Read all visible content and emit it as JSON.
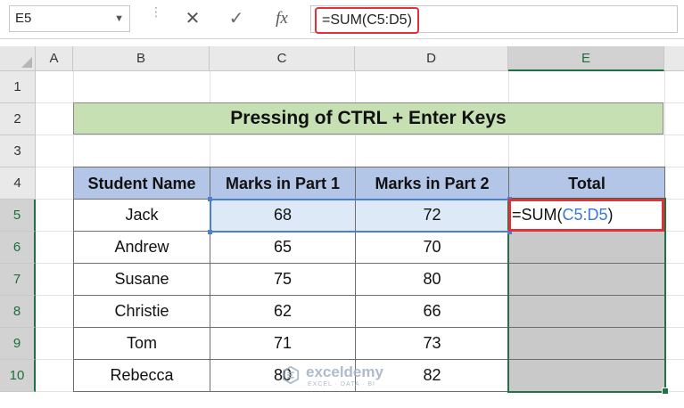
{
  "formula_bar": {
    "name_box": "E5",
    "cancel_icon": "✕",
    "enter_icon": "✓",
    "fx_label": "fx",
    "formula": "=SUM(C5:D5)"
  },
  "columns": [
    "A",
    "B",
    "C",
    "D",
    "E"
  ],
  "rows": [
    "1",
    "2",
    "3",
    "4",
    "5",
    "6",
    "7",
    "8",
    "9",
    "10"
  ],
  "selected_column": "E",
  "title": "Pressing of CTRL + Enter Keys",
  "table": {
    "headers": [
      "Student Name",
      "Marks in Part 1",
      "Marks in Part 2",
      "Total"
    ],
    "rows": [
      [
        "Jack",
        "68",
        "72"
      ],
      [
        "Andrew",
        "65",
        "70"
      ],
      [
        "Susane",
        "75",
        "80"
      ],
      [
        "Christie",
        "62",
        "66"
      ],
      [
        "Tom",
        "71",
        "73"
      ],
      [
        "Rebecca",
        "80",
        "82"
      ]
    ]
  },
  "active_cell": {
    "prefix": "=SUM(",
    "ref": "C5:D5",
    "suffix": ")"
  },
  "watermark": {
    "name": "exceldemy",
    "tagline": "EXCEL · DATA · BI"
  },
  "colors": {
    "title_fill": "#c6e0b4",
    "header_fill": "#b4c6e7",
    "reference_highlight": "#4a7fd1",
    "formula_highlight": "#e0303a",
    "selection_green": "#217346"
  }
}
